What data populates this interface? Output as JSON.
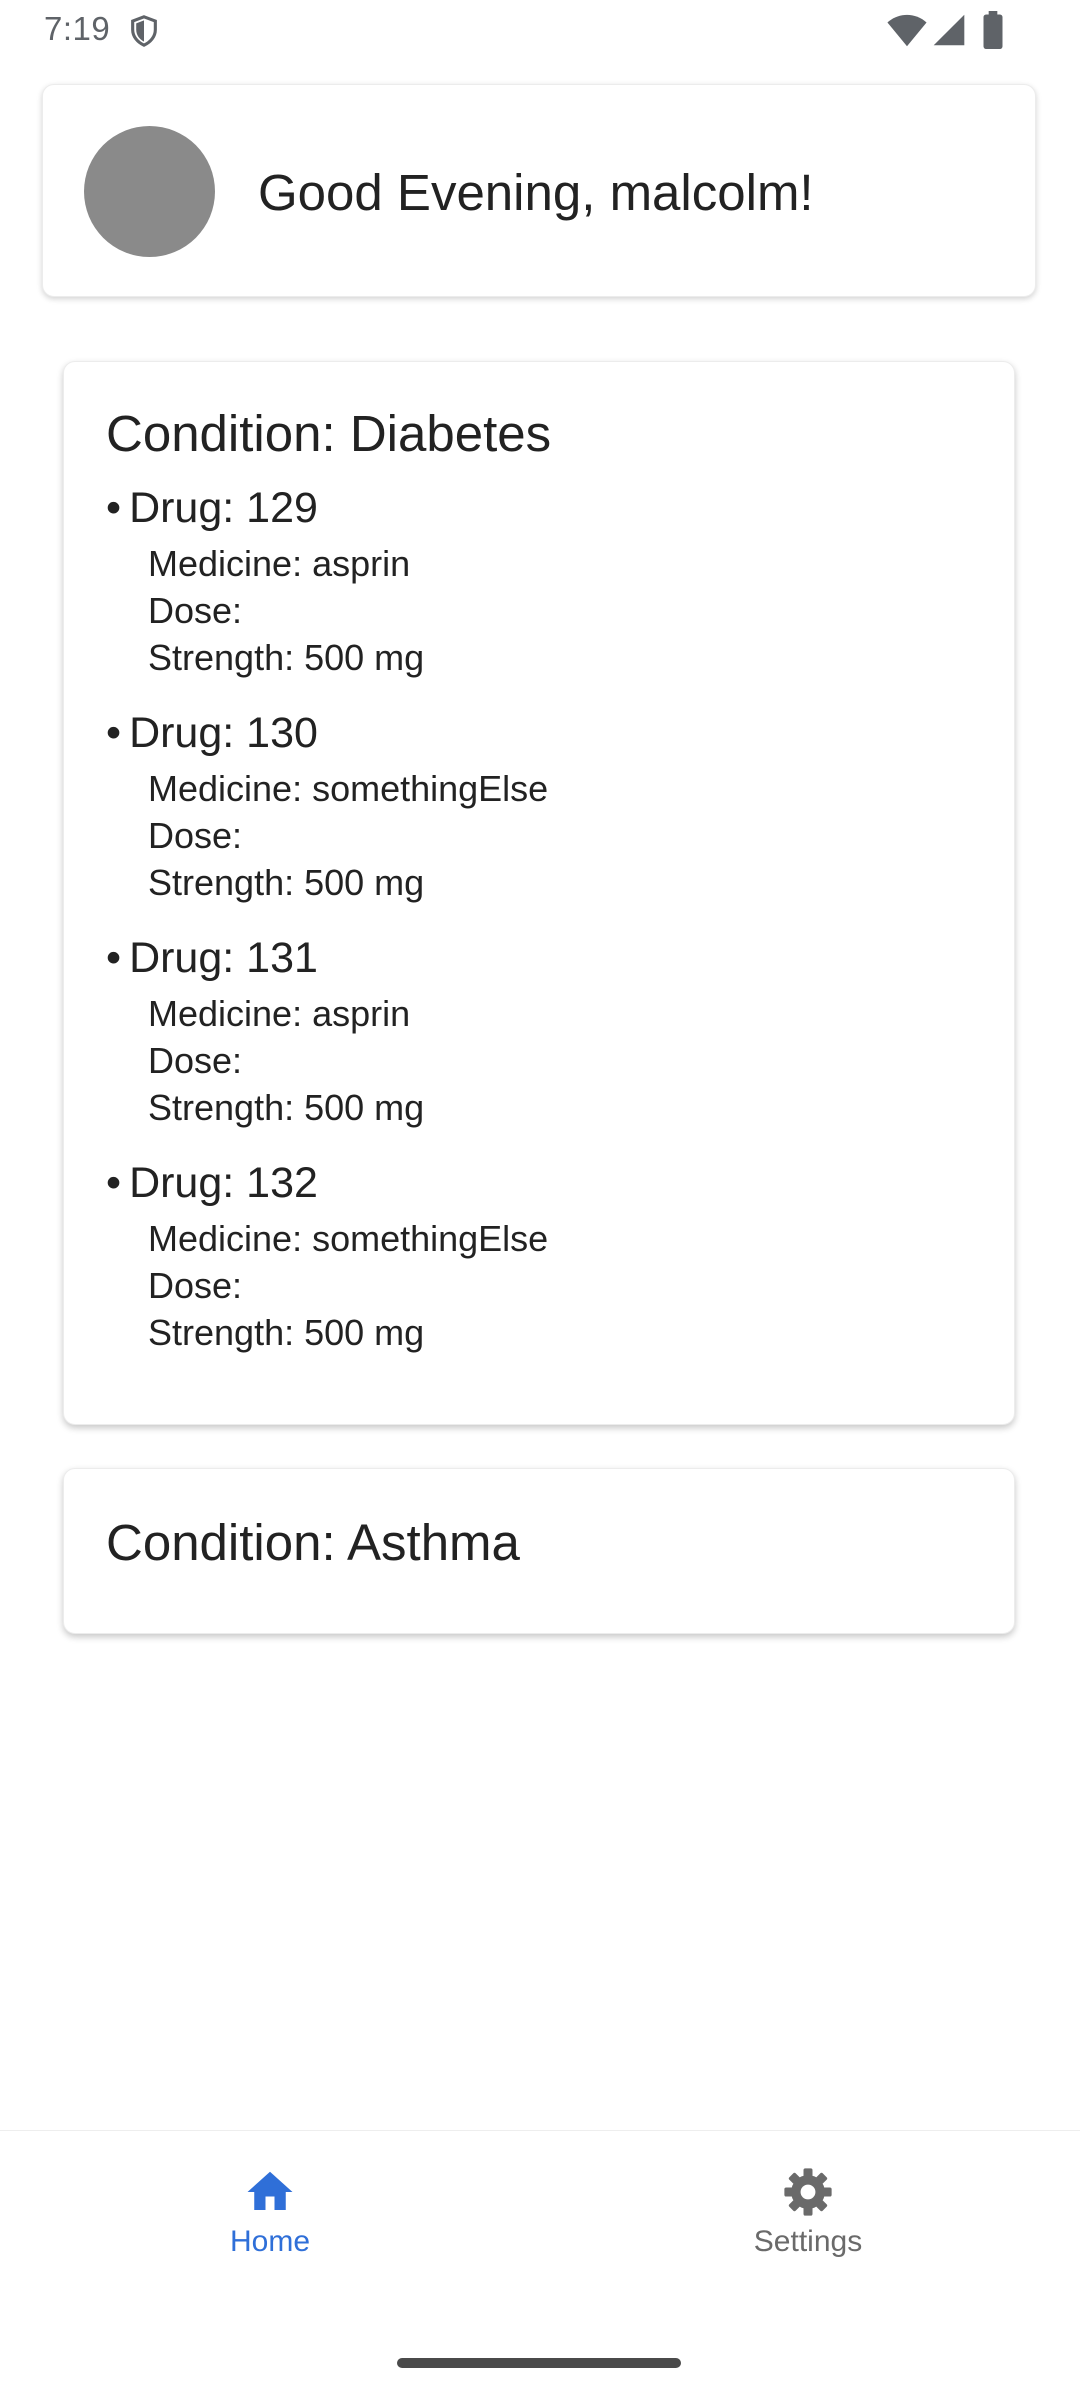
{
  "status_bar": {
    "time": "7:19",
    "icons": [
      "shield-icon",
      "wifi-icon",
      "signal-icon",
      "battery-icon"
    ]
  },
  "greeting": {
    "text": "Good Evening, malcolm!"
  },
  "conditions": [
    {
      "title": "Condition: Diabetes",
      "drugs": [
        {
          "bullet": "•",
          "heading": "Drug: 129",
          "medicine": "Medicine: asprin",
          "dose": "Dose:",
          "strength": "Strength: 500 mg"
        },
        {
          "bullet": "•",
          "heading": "Drug: 130",
          "medicine": "Medicine: somethingElse",
          "dose": "Dose:",
          "strength": "Strength: 500 mg"
        },
        {
          "bullet": "•",
          "heading": "Drug: 131",
          "medicine": "Medicine: asprin",
          "dose": "Dose:",
          "strength": "Strength: 500 mg"
        },
        {
          "bullet": "•",
          "heading": "Drug: 132",
          "medicine": "Medicine: somethingElse",
          "dose": "Dose:",
          "strength": "Strength: 500 mg"
        }
      ]
    },
    {
      "title": "Condition: Asthma",
      "drugs": []
    }
  ],
  "bottom_nav": {
    "items": [
      {
        "label": "Home",
        "icon": "home-icon",
        "active": true
      },
      {
        "label": "Settings",
        "icon": "gear-icon",
        "active": false
      }
    ]
  },
  "colors": {
    "accent": "#2f6fd8",
    "inactive": "#6a6a6a",
    "avatar": "#8a8a8a",
    "text": "#222222"
  }
}
